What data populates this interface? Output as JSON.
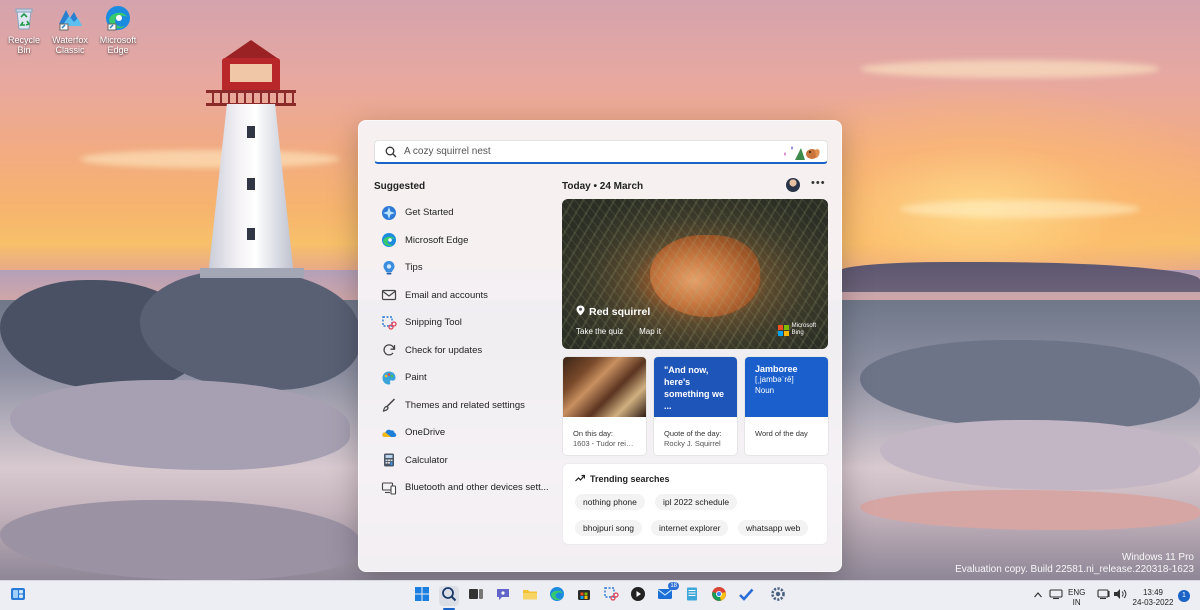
{
  "desktop": {
    "icons": [
      {
        "label": "Recycle Bin"
      },
      {
        "label": "Waterfox Classic"
      },
      {
        "label": "Microsoft Edge"
      }
    ],
    "watermark": {
      "line1": "Windows 11 Pro",
      "line2": "Evaluation copy. Build 22581.ni_release.220318-1623"
    }
  },
  "search": {
    "placeholder": "A cozy squirrel nest"
  },
  "suggested": {
    "title": "Suggested",
    "items": [
      {
        "label": "Get Started",
        "icon": "get-started-icon"
      },
      {
        "label": "Microsoft Edge",
        "icon": "edge-icon"
      },
      {
        "label": "Tips",
        "icon": "tips-icon"
      },
      {
        "label": "Email and accounts",
        "icon": "mail-icon"
      },
      {
        "label": "Snipping Tool",
        "icon": "snipping-tool-icon"
      },
      {
        "label": "Check for updates",
        "icon": "refresh-icon"
      },
      {
        "label": "Paint",
        "icon": "paint-icon"
      },
      {
        "label": "Themes and related settings",
        "icon": "brush-icon"
      },
      {
        "label": "OneDrive",
        "icon": "onedrive-icon"
      },
      {
        "label": "Calculator",
        "icon": "calculator-icon"
      },
      {
        "label": "Bluetooth and other devices sett...",
        "icon": "bluetooth-devices-icon"
      }
    ]
  },
  "today": {
    "title": "Today  •  24 March",
    "hero": {
      "title": "Red squirrel",
      "action1": "Take the quiz",
      "action2": "Map it",
      "brand_line1": "Microsoft",
      "brand_line2": "Bing"
    },
    "cards": [
      {
        "caption": "On this day:",
        "sub": "1603 - Tudor reig..."
      },
      {
        "quote": "\"And now, here's something we ...",
        "caption": "Quote of the day:",
        "sub": "Rocky J. Squirrel"
      },
      {
        "word": "Jamboree",
        "pron": "[ˌjambəˈrē]",
        "pos": "Noun",
        "caption": "Word of the day"
      }
    ],
    "trending": {
      "title": "Trending searches",
      "chips": [
        "nothing phone",
        "ipl 2022 schedule",
        "bhojpuri song",
        "internet explorer",
        "whatsapp web"
      ]
    }
  },
  "taskbar": {
    "lang_line1": "ENG",
    "lang_line2": "IN",
    "time": "13:49",
    "date": "24-03-2022",
    "notification_count": "1",
    "store_badge": "18"
  },
  "colors": {
    "accent": "#1a64c8",
    "panel": "#f6f3f6",
    "taskbar": "#edeef3"
  }
}
